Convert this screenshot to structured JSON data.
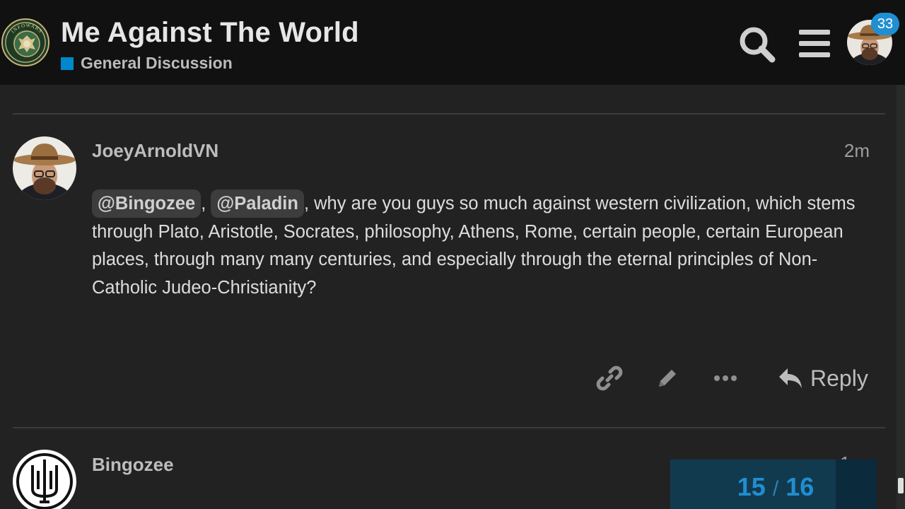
{
  "header": {
    "logo_icon": "army-seal-logo",
    "logo_text": "INFOWARS ARMY",
    "title": "Me Against The World",
    "category": {
      "label": "General Discussion",
      "color": "#0088cc"
    },
    "search_icon": "search-icon",
    "menu_icon": "hamburger-menu-icon",
    "notification_count": "33"
  },
  "post": {
    "username": "JoeyArnoldVN",
    "date": "2m",
    "mentions": [
      "@Bingozee",
      "@Paladin"
    ],
    "separator": ",",
    "body": ", why are you guys so much against western civilization, which stems through Plato, Aristotle, Socrates, philosophy, Athens, Rome, certain people, certain European places, through many many centuries, and especially through the eternal principles of Non-Catholic Judeo-Christianity?",
    "actions": {
      "link_icon": "link-icon",
      "edit_icon": "pencil-icon",
      "more_icon": "ellipsis-icon",
      "reply_icon": "reply-arrow-icon",
      "reply_label": "Reply"
    }
  },
  "next_post": {
    "username": "Bingozee",
    "date": "1"
  },
  "timeline": {
    "current": "15",
    "separator": "/",
    "total": "16",
    "progress_fraction": 0.8,
    "color": "#1f8fd1"
  }
}
